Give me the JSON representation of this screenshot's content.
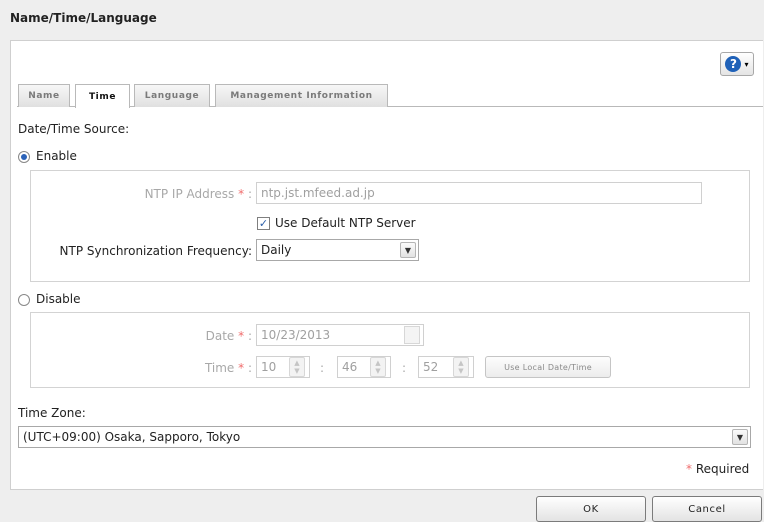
{
  "dialog": {
    "title": "Name/Time/Language"
  },
  "help": {
    "glyph": "?",
    "caret": "▾"
  },
  "tabs": [
    {
      "label": "Name",
      "active": false
    },
    {
      "label": "Time",
      "active": true
    },
    {
      "label": "Language",
      "active": false
    },
    {
      "label": "Management Information",
      "active": false
    }
  ],
  "form": {
    "source_label": "Date/Time Source:",
    "enable_label": "Enable",
    "enable_selected": true,
    "ntp_ip_label": "NTP IP Address",
    "ntp_ip_value": "ntp.jst.mfeed.ad.jp",
    "use_default_label": "Use Default NTP Server",
    "use_default_checked": true,
    "frequency_label": "NTP Synchronization Frequency:",
    "frequency_value": "Daily",
    "disable_label": "Disable",
    "disable_selected": false,
    "date_label": "Date",
    "date_value": "10/23/2013",
    "time_label": "Time",
    "time_hour": "10",
    "time_minute": "46",
    "time_second": "52",
    "time_sep": ":",
    "use_local_label": "Use Local Date/Time",
    "timezone_label": "Time Zone:",
    "timezone_value": "(UTC+09:00) Osaka, Sapporo, Tokyo",
    "required_mark": "*",
    "required_label": "Required"
  },
  "footer": {
    "ok_label": "OK",
    "cancel_label": "Cancel"
  },
  "colors": {
    "accent": "#1f61b8",
    "required": "#f06c6c"
  }
}
